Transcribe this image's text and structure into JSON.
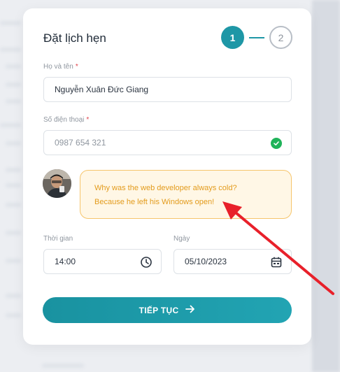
{
  "form": {
    "title": "Đặt lịch hẹn",
    "steps": [
      "1",
      "2"
    ],
    "name_label": "Họ và tên",
    "name_value": "Nguyễn Xuân Đức Giang",
    "phone_label": "Số điện thoại",
    "phone_value": "0987 654 321",
    "required_mark": "*",
    "chat_line1": "Why was the web developer always cold?",
    "chat_line2": "Because he left his Windows open!",
    "time_label": "Thời gian",
    "time_value": "14:00",
    "date_label": "Ngày",
    "date_value": "05/10/2023",
    "submit_label": "TIẾP TỤC"
  },
  "colors": {
    "accent": "#1e97a6",
    "success": "#20b35a",
    "bubble_text": "#e39b1c",
    "bubble_border": "#f6c56b",
    "annotation_arrow": "#e8202a"
  },
  "icons": [
    "check-circle-icon",
    "clock-icon",
    "calendar-icon",
    "arrow-right-icon"
  ]
}
